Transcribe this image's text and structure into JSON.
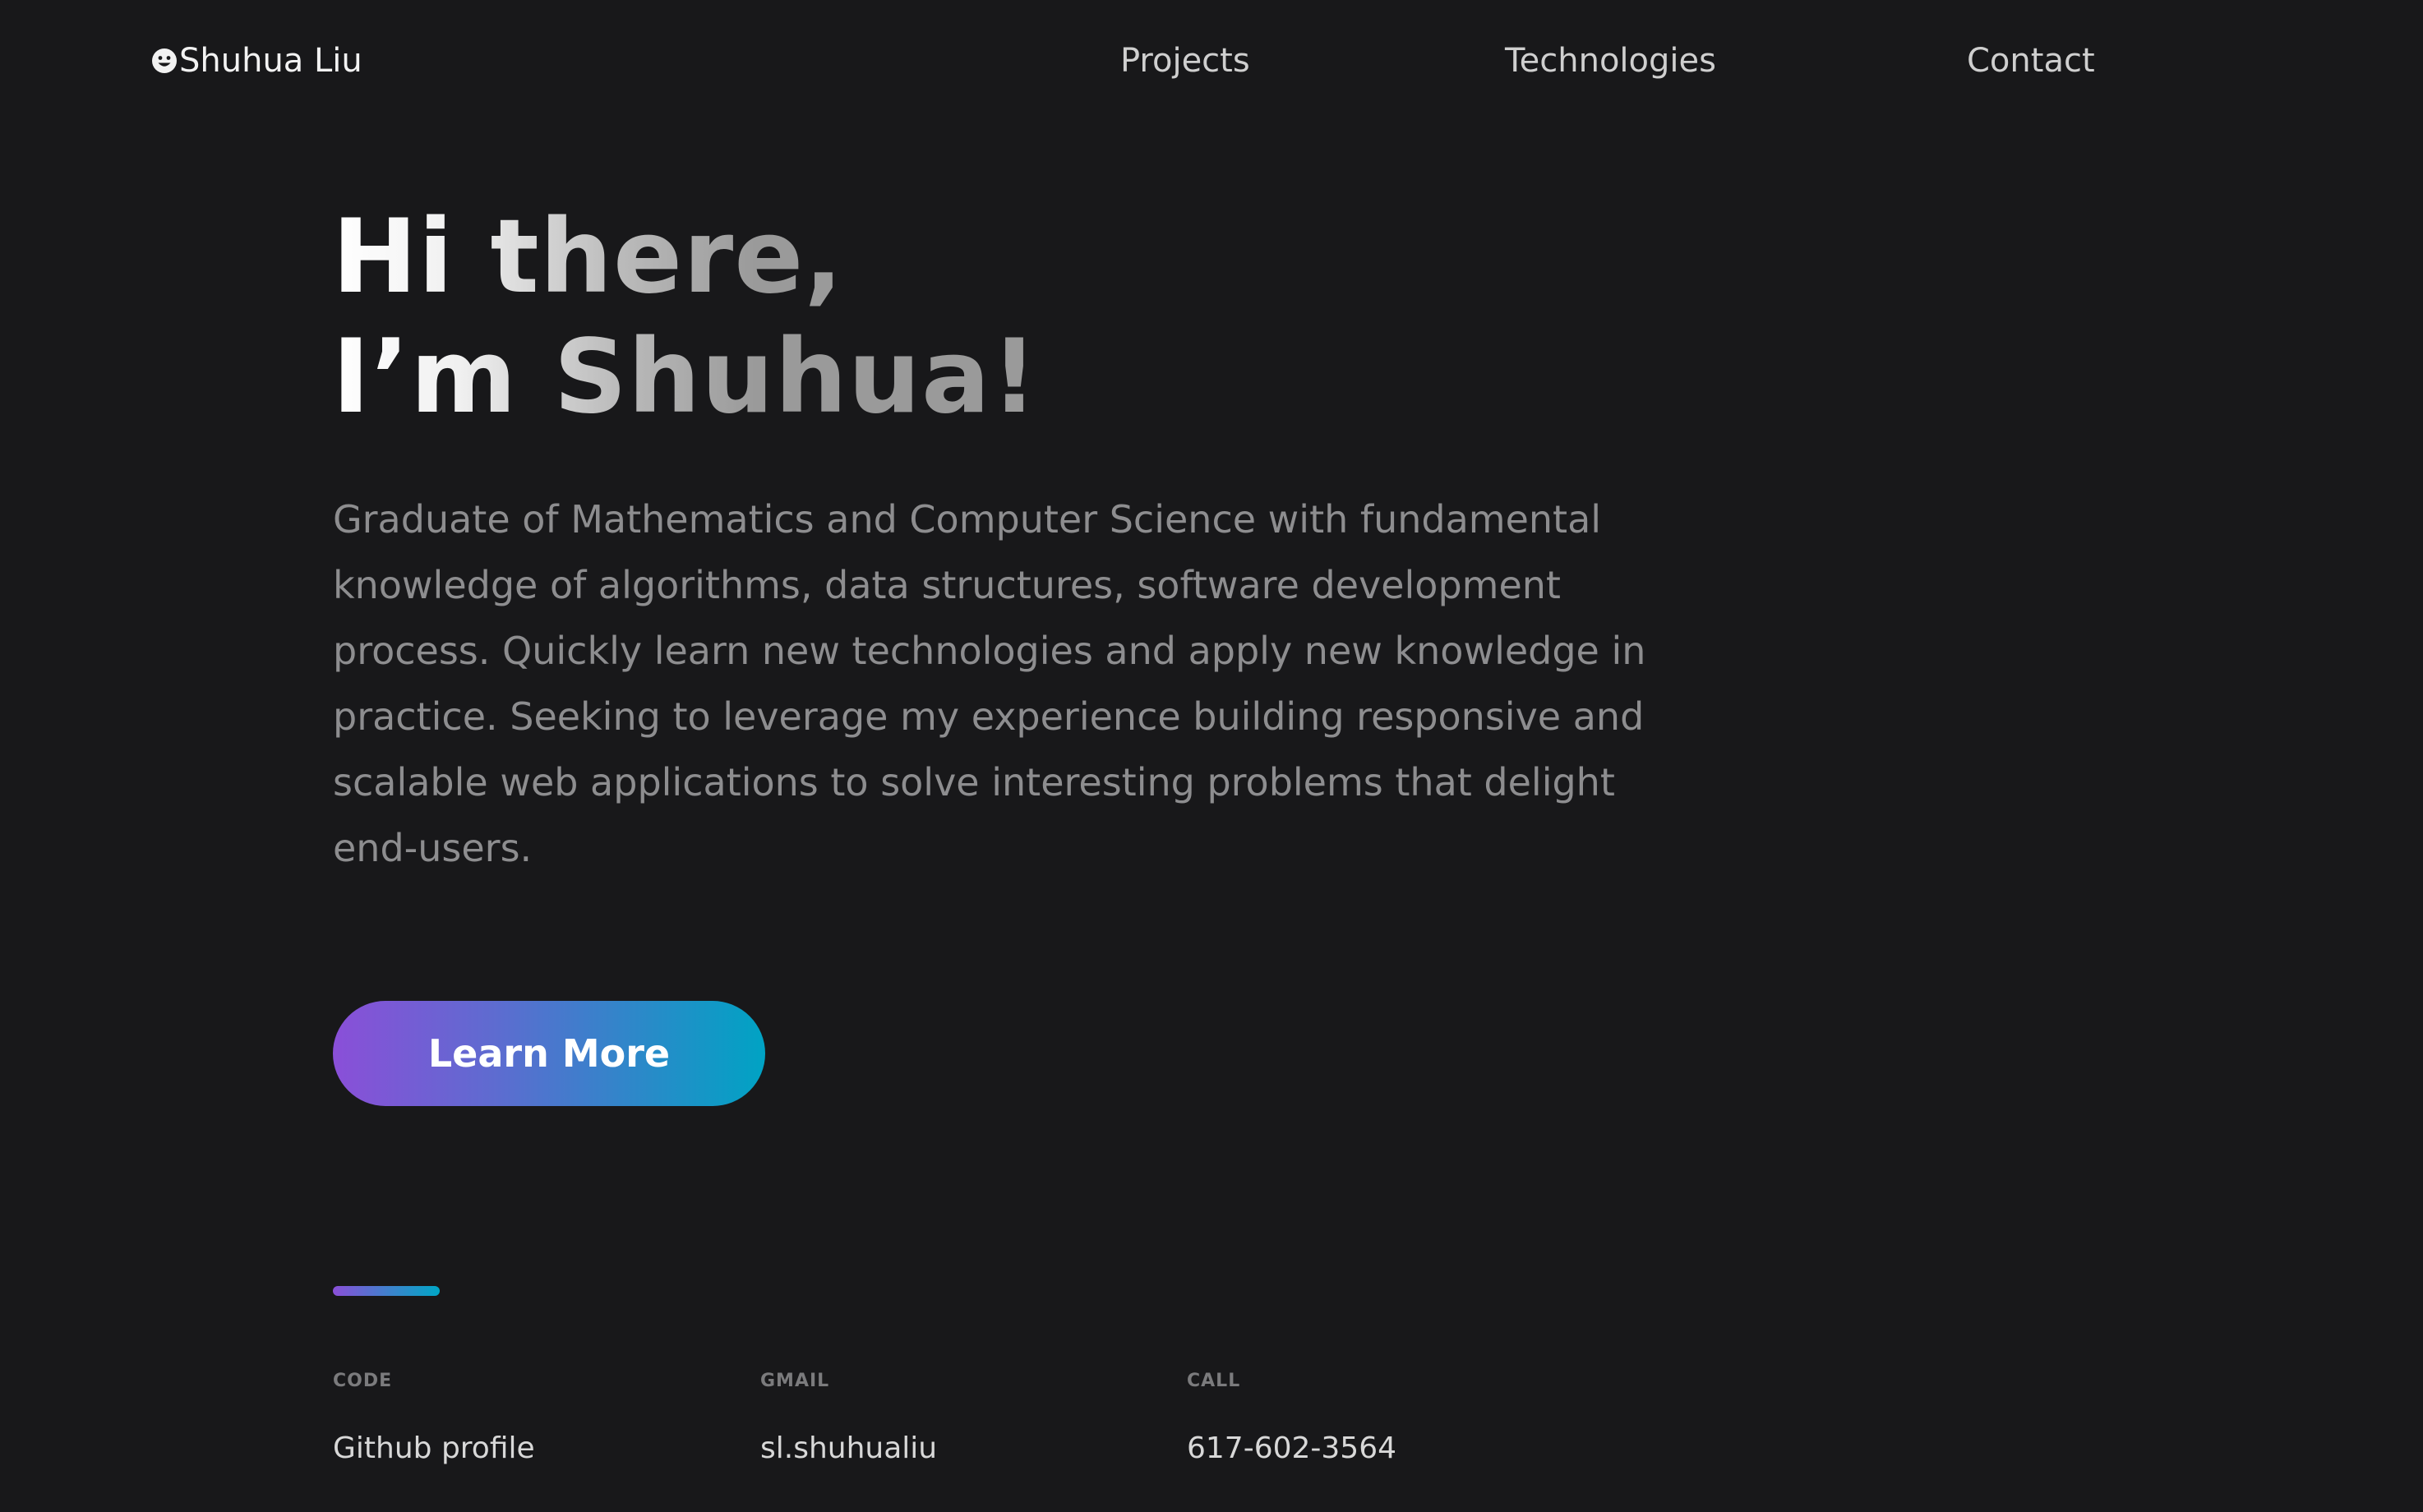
{
  "nav": {
    "brand": "Shuhua Liu",
    "brand_icon": "smiley-icon",
    "links": [
      "Projects",
      "Technologies",
      "Contact"
    ]
  },
  "hero": {
    "title_line1": "Hi there,",
    "title_line2": "I’m Shuhua!",
    "description": "Graduate of Mathematics and Computer Science with fundamental knowledge of algorithms, data structures, software development process. Quickly learn new technologies and apply new knowledge in practice. Seeking to leverage my experience building responsive and scalable web applications to solve interesting problems that delight end-users.",
    "button_label": "Learn More"
  },
  "contact": [
    {
      "label": "CODE",
      "value": "Github profile"
    },
    {
      "label": "GMAIL",
      "value": "sl.shuhualiu"
    },
    {
      "label": "CALL",
      "value": "617-602-3564"
    }
  ],
  "colors": {
    "background": "#18181a",
    "gradient_start": "#8a4fd8",
    "gradient_end": "#00a3c4",
    "muted_text": "#8d8d8f"
  }
}
